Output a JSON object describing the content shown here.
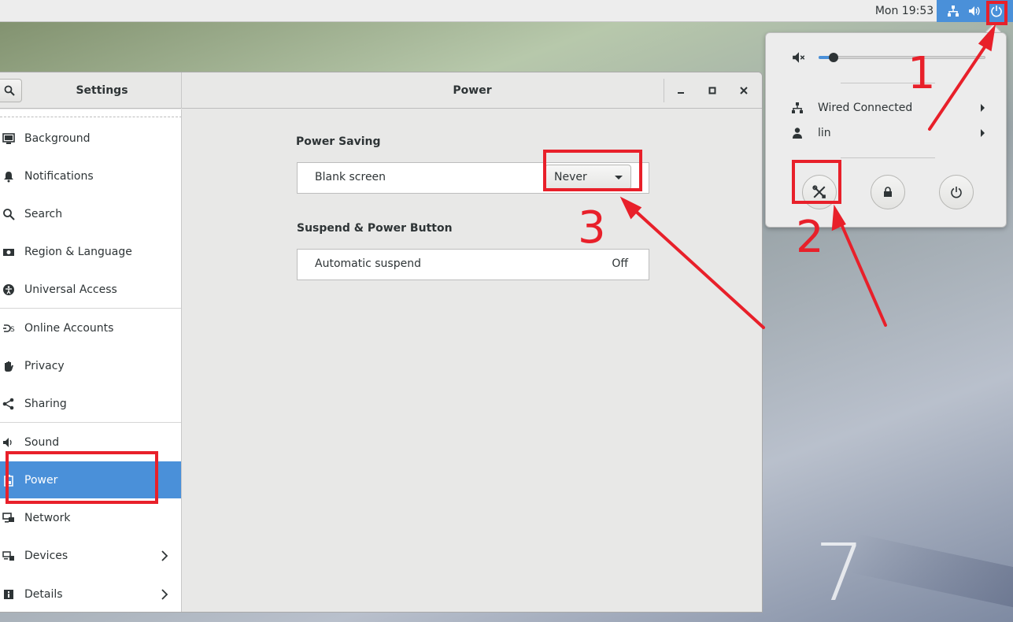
{
  "topbar": {
    "clock": "Mon 19:53",
    "icons": [
      "network-wired-icon",
      "volume-icon",
      "power-icon"
    ],
    "tray_color": "#4a90d9"
  },
  "wallpaper": {
    "number": "7"
  },
  "window": {
    "sidebar_title": "Settings",
    "panel_title": "Power",
    "buttons": {
      "minimize": "‒",
      "maximize": "□",
      "close": "×"
    }
  },
  "sidebar": {
    "items": [
      {
        "label": "Background",
        "icon": "background-icon"
      },
      {
        "label": "Notifications",
        "icon": "bell-icon"
      },
      {
        "label": "Search",
        "icon": "search-icon"
      },
      {
        "label": "Region & Language",
        "icon": "flag-icon"
      },
      {
        "label": "Universal Access",
        "icon": "accessibility-icon"
      },
      {
        "label": "Online Accounts",
        "icon": "online-accounts-icon"
      },
      {
        "label": "Privacy",
        "icon": "hand-icon"
      },
      {
        "label": "Sharing",
        "icon": "share-icon"
      },
      {
        "label": "Sound",
        "icon": "speaker-icon"
      },
      {
        "label": "Power",
        "icon": "battery-icon",
        "active": true
      },
      {
        "label": "Network",
        "icon": "network-icon"
      },
      {
        "label": "Devices",
        "icon": "devices-icon",
        "has_submenu": true
      },
      {
        "label": "Details",
        "icon": "info-icon",
        "has_submenu": true
      }
    ],
    "active_color": "#4a90d9"
  },
  "power_panel": {
    "power_saving": {
      "title": "Power Saving",
      "blank_screen_label": "Blank screen",
      "blank_screen_value": "Never"
    },
    "suspend": {
      "title": "Suspend & Power Button",
      "automatic_suspend_label": "Automatic suspend",
      "automatic_suspend_value": "Off"
    }
  },
  "system_menu": {
    "volume_level": 0.07,
    "network_label": "Wired Connected",
    "user_label": "lin",
    "buttons": [
      "settings-icon",
      "lock-icon",
      "power-off-icon"
    ]
  },
  "annotations": {
    "color": "#e8202a",
    "labels": [
      "1",
      "2",
      "3"
    ]
  }
}
